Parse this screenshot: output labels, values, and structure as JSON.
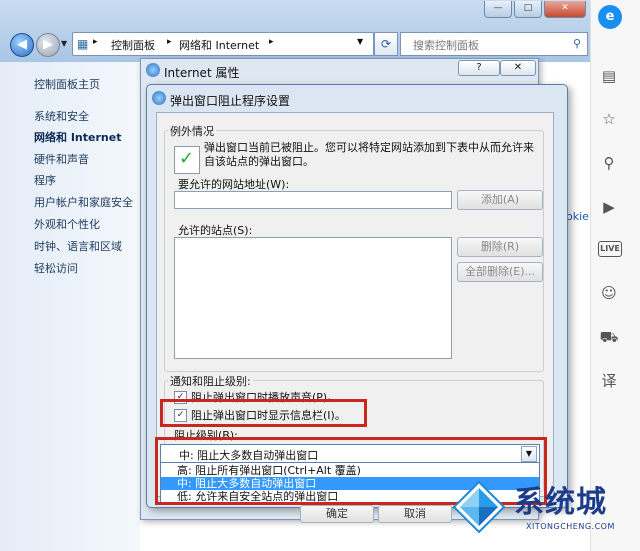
{
  "explorer": {
    "address_segments": [
      "控制面板",
      "网络和 Internet"
    ],
    "search_placeholder": "搜索控制面板",
    "window_buttons": {
      "minimize": "—",
      "maximize": "□",
      "close": "✕"
    }
  },
  "left_pane": {
    "home": "控制面板主页",
    "items": [
      "系统和安全",
      "网络和 Internet",
      "硬件和声音",
      "程序",
      "用户帐户和家庭安全",
      "外观和个性化",
      "时钟、语言和区域",
      "轻松访问"
    ],
    "active_index": 1
  },
  "background_text": "okie",
  "internet_properties": {
    "title": "Internet 属性",
    "help_label": "?",
    "close_label": "✕"
  },
  "popup_dialog": {
    "title": "弹出窗口阻止程序设置",
    "exceptions_group_label": "例外情况",
    "info_text": "弹出窗口当前已被阻止。您可以将特定网站添加到下表中从而允许来自该站点的弹出窗口。",
    "address_label": "要允许的网站地址(W):",
    "address_value": "",
    "add_button": "添加(A)",
    "allowed_sites_label": "允许的站点(S):",
    "remove_button": "删除(R)",
    "remove_all_button": "全部删除(E)...",
    "notify_group_label": "通知和阻止级别:",
    "checkbox_sound": {
      "label": "阻止弹出窗口时播放声音(P)。",
      "checked": true
    },
    "checkbox_infobar": {
      "label": "阻止弹出窗口时显示信息栏(I)。",
      "checked": true
    },
    "block_level_label": "阻止级别(B):",
    "block_level_selected": "中: 阻止大多数自动弹出窗口",
    "block_level_options": [
      "高: 阻止所有弹出窗口(Ctrl+Alt 覆盖)",
      "中: 阻止大多数自动弹出窗口",
      "低: 允许来自安全站点的弹出窗口"
    ],
    "selected_option_index": 1,
    "bottom_buttons": [
      "确定",
      "取消"
    ]
  },
  "sidebar_icons": [
    "news-icon",
    "star-icon",
    "search-icon",
    "video-icon",
    "live-icon",
    "chat-icon",
    "cart-icon",
    "translate-icon"
  ],
  "sidebar_live_label": "LIVE",
  "watermark": {
    "title": "系统城",
    "subtitle": "XITONGCHENG.COM"
  },
  "colors": {
    "highlight_red": "#c8281e",
    "selection_blue": "#3399ff",
    "brand_blue": "#1c3c8a"
  }
}
